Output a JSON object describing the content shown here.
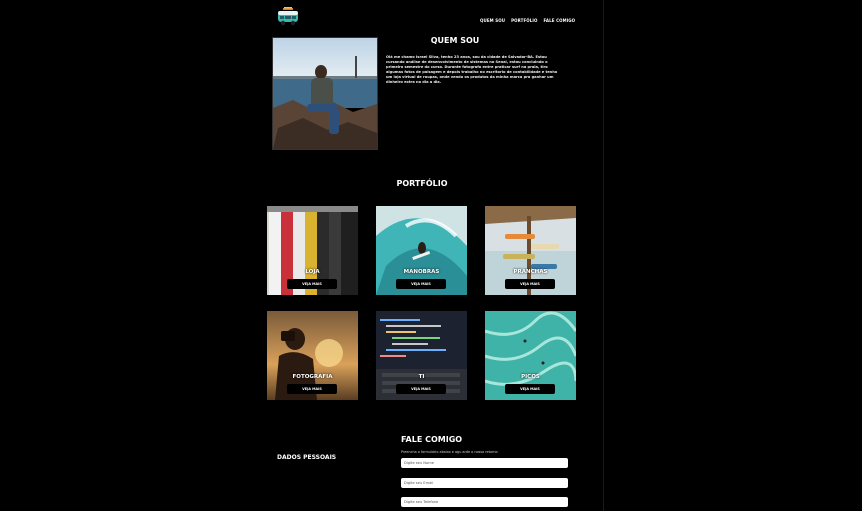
{
  "header": {
    "logo_icon": "surf-van-icon",
    "nav": [
      "QUEM SOU",
      "PORTFÓLIO",
      "FALE COMIGO"
    ]
  },
  "about": {
    "title": "QUEM SOU",
    "text": "Olá me chamo Israel Silva, tenho 23 anos, sou da cidade de Salvador-BA. Estou cursando análise de desenvolvimento de sistemas no Senai, estou concluindo o primeiro semestre do curso. Durante fotografo entre praticar surf na praia, tiro algumas fotos de paisagem e depois trabalho no escritorio de contabilidade e tenho um loja virtual de roupas, onde vendo os produtos da minha marca pra ganhar um dinheiro extra no dia a dia."
  },
  "portfolio": {
    "title": "PORTFÓLIO",
    "button_label": "VEJA MAIS",
    "items": [
      {
        "label": "LOJA"
      },
      {
        "label": "MANOBRAS"
      },
      {
        "label": "PRANCHAS"
      },
      {
        "label": "FOTOGRAFIA"
      },
      {
        "label": "TI"
      },
      {
        "label": "PICOS"
      }
    ]
  },
  "contact": {
    "title": "FALE COMIGO",
    "subtitle": "Preencha o formulário abaixo e agu arde o nosso retorno",
    "personal_title": "DADOS PESSOAIS",
    "fields": [
      {
        "placeholder": "Digite seu Nome"
      },
      {
        "placeholder": "Digite seu Email"
      },
      {
        "placeholder": "Digite seu Telefone"
      }
    ]
  }
}
